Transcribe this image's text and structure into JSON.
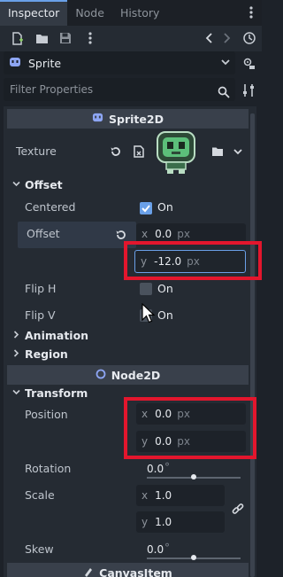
{
  "tabs": [
    {
      "label": "Inspector"
    },
    {
      "label": "Node"
    },
    {
      "label": "History"
    }
  ],
  "object_selector": {
    "label": "Sprite"
  },
  "filter": {
    "placeholder": "Filter Properties"
  },
  "sprite2d_section": {
    "title": "Sprite2D"
  },
  "texture": {
    "label": "Texture"
  },
  "offset_group": {
    "label": "Offset"
  },
  "centered": {
    "label": "Centered",
    "value": "On"
  },
  "offset": {
    "label": "Offset",
    "x_axis": "x",
    "x_value": "0.0",
    "x_unit": "px",
    "y_axis": "y",
    "y_value": "-12.0",
    "y_unit": "px"
  },
  "flip_h": {
    "label": "Flip H",
    "value": "On"
  },
  "flip_v": {
    "label": "Flip V",
    "value": "On"
  },
  "animation_group": {
    "label": "Animation"
  },
  "region_group": {
    "label": "Region"
  },
  "node2d_section": {
    "title": "Node2D"
  },
  "transform_group": {
    "label": "Transform"
  },
  "position": {
    "label": "Position",
    "x_axis": "x",
    "x_value": "0.0",
    "x_unit": "px",
    "y_axis": "y",
    "y_value": "0.0",
    "y_unit": "px"
  },
  "rotation": {
    "label": "Rotation",
    "value": "0.0",
    "unit": "°"
  },
  "scale": {
    "label": "Scale",
    "x_axis": "x",
    "x_value": "1.0",
    "y_axis": "y",
    "y_value": "1.0"
  },
  "skew": {
    "label": "Skew",
    "value": "0.0",
    "unit": "°"
  },
  "canvasitem_section": {
    "title": "CanvasItem"
  },
  "colors": {
    "accent": "#6aa0e8",
    "highlight": "#e3162d",
    "background": "#1d2229"
  }
}
